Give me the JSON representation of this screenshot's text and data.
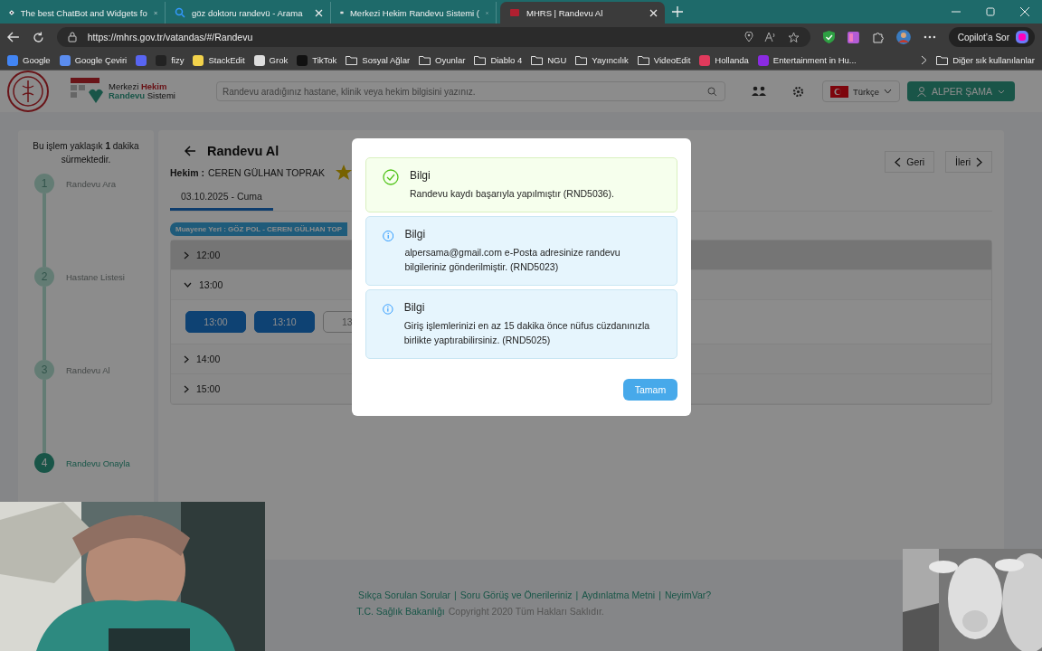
{
  "browser": {
    "tabs": [
      {
        "title": "The best ChatBot and Widgets fo",
        "selected": false
      },
      {
        "title": "göz doktoru randevü - Arama",
        "selected": false
      },
      {
        "title": "Merkezi Hekim Randevu Sistemi (",
        "selected": false
      },
      {
        "title": "MHRS | Randevu Al",
        "selected": true
      }
    ],
    "address": "https://mhrs.gov.tr/vatandas/#/Randevu",
    "copilot": "Copilot’a Sor",
    "bookmarks": [
      {
        "label": "Google",
        "kind": "site",
        "color": "#4285f4"
      },
      {
        "label": "Google Çeviri",
        "kind": "site",
        "color": "#5b8def"
      },
      {
        "kind": "icon",
        "color": "#5865f2"
      },
      {
        "label": "fizy",
        "kind": "site",
        "color": "#222222"
      },
      {
        "label": "StackEdit",
        "kind": "site",
        "color": "#f2d24b"
      },
      {
        "label": "Grok",
        "kind": "site",
        "color": "#dddddd"
      },
      {
        "label": "TikTok",
        "kind": "site",
        "color": "#111111"
      },
      {
        "label": "Sosyal Ağlar",
        "kind": "folder"
      },
      {
        "label": "Oyunlar",
        "kind": "folder"
      },
      {
        "label": "Diablo 4",
        "kind": "folder"
      },
      {
        "label": "NGU",
        "kind": "folder"
      },
      {
        "label": "Yayıncılık",
        "kind": "folder"
      },
      {
        "label": "VideoEdit",
        "kind": "folder"
      },
      {
        "label": "Hollanda",
        "kind": "site",
        "color": "#e03a5c"
      },
      {
        "label": "Entertainment in Hu...",
        "kind": "site",
        "color": "#8a2be2"
      }
    ],
    "other_bookmarks": "Diğer sık kullanılanlar"
  },
  "header": {
    "logo_top": "Merkezi **Hekim**",
    "logo_bottom": "**Randevu** Sistemi",
    "search_placeholder": "Randevu aradığınız hastane, klinik veya hekim bilgisini yazınız.",
    "language": "Türkçe",
    "user": "ALPER ŞAMA"
  },
  "steps": {
    "note": "Bu işlem yaklaşık **1** dakika sürmektedir.",
    "items": [
      {
        "number": "1",
        "label": "Randevu Ara",
        "selected": false
      },
      {
        "number": "2",
        "label": "Hastane Listesi",
        "selected": false
      },
      {
        "number": "3",
        "label": "Randevu Al",
        "selected": false
      },
      {
        "number": "4",
        "label": "Randevu Onayla",
        "selected": true
      }
    ]
  },
  "main": {
    "title": "Randevu Al",
    "doctor_label": "Hekim :",
    "doctor": "CEREN GÜLHAN TOPRAK",
    "favorite": true,
    "date_tabs": [
      {
        "label": "03.10.2025 - Cuma",
        "selected": true
      }
    ],
    "location": "Muayene Yeri : GÖZ POL - CEREN GÜLHAN TOP",
    "hours": [
      {
        "time": "12:00",
        "expanded": false,
        "highlighted": true
      },
      {
        "time": "13:00",
        "expanded": true,
        "highlighted": false,
        "slots": [
          {
            "time": "13:00",
            "available": true
          },
          {
            "time": "13:10",
            "available": true
          },
          {
            "time": "13",
            "available": false
          }
        ]
      },
      {
        "time": "14:00",
        "expanded": false,
        "highlighted": false
      },
      {
        "time": "15:00",
        "expanded": false,
        "highlighted": false
      }
    ],
    "back": "Geri",
    "next": "İleri"
  },
  "modal": {
    "messages": [
      {
        "kind": "success",
        "title": "Bilgi",
        "text": "Randevu kaydı başarıyla yapılmıştır (RND5036)."
      },
      {
        "kind": "info",
        "title": "Bilgi",
        "text": "alpersama@gmail.com e-Posta adresinize randevu bilgileriniz gönderilmiştir. (RND5023)"
      },
      {
        "kind": "info",
        "title": "Bilgi",
        "text": "Giriş işlemlerinizi en az 15 dakika önce nüfus cüzdanınızla birlikte yaptırabilirsiniz. (RND5025)"
      }
    ],
    "button": "Tamam"
  },
  "footer": {
    "separator": "|",
    "links": [
      "Sıkça Sorulan Sorular",
      "Soru Görüş ve Önerileriniz",
      "Aydınlatma Metni",
      "NeyimVar?"
    ],
    "ministry": "T.C. Sağlık Bakanlığı",
    "copyright": "Copyright 2020 Tüm Hakları Saklıdır."
  }
}
